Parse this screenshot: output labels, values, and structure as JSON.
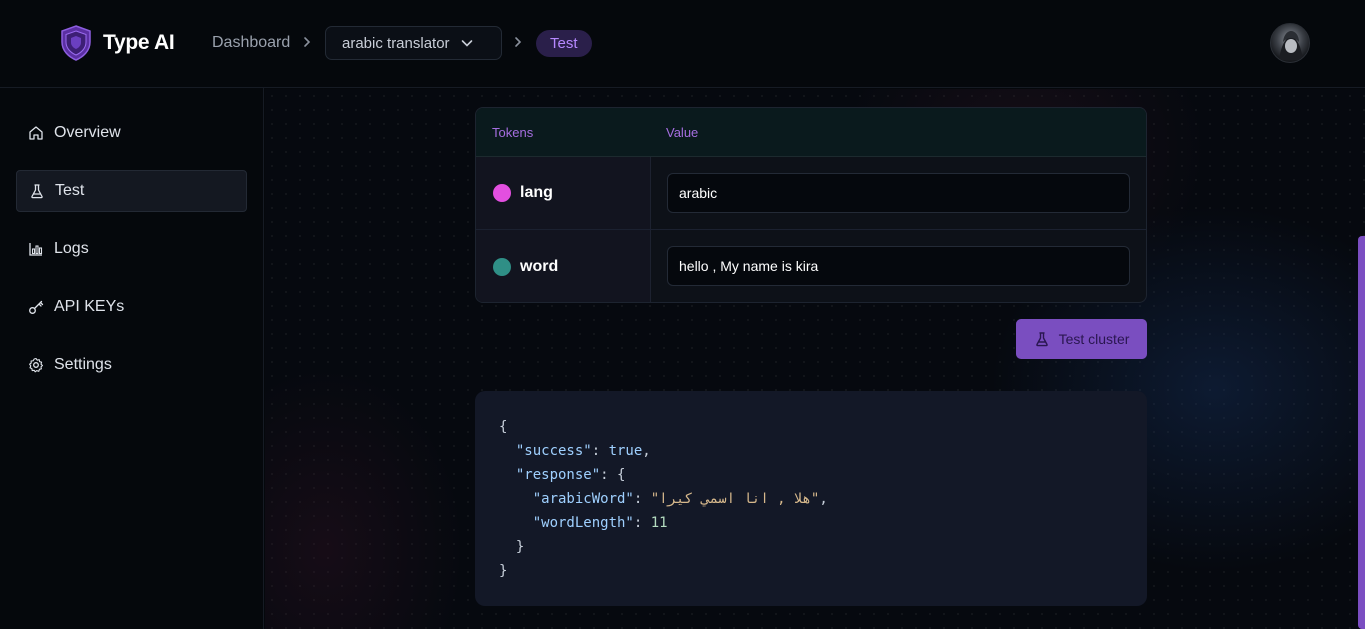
{
  "header": {
    "brand": "Type AI",
    "breadcrumb_dashboard": "Dashboard",
    "project_select": "arabic translator",
    "current_page_badge": "Test"
  },
  "sidebar": {
    "items": [
      {
        "label": "Overview",
        "icon": "home-icon",
        "active": false
      },
      {
        "label": "Test",
        "icon": "flask-icon",
        "active": true
      },
      {
        "label": "Logs",
        "icon": "bar-chart-icon",
        "active": false
      },
      {
        "label": "API KEYs",
        "icon": "key-icon",
        "active": false
      },
      {
        "label": "Settings",
        "icon": "gear-icon",
        "active": false
      }
    ]
  },
  "tokens": {
    "header_tokens": "Tokens",
    "header_value": "Value",
    "rows": [
      {
        "name": "lang",
        "value": "arabic",
        "color": "#e34fe0"
      },
      {
        "name": "word",
        "value": "hello , My name is kira",
        "color": "#2f8f86"
      }
    ]
  },
  "test_button": {
    "label": "Test cluster",
    "icon": "flask-icon"
  },
  "response": {
    "open_brace": "{",
    "success_key": "\"success\"",
    "success_value": "true",
    "response_key": "\"response\"",
    "arabicWord_key": "\"arabicWord\"",
    "arabicWord_value": "\"هلا , انا اسمي كيرا\"",
    "wordLength_key": "\"wordLength\"",
    "wordLength_value": "11",
    "inner_close": "}",
    "close_brace": "}"
  },
  "colors": {
    "accent": "#7a4ec0",
    "badge_text": "#b688ff",
    "token_header_text": "#a56ee0"
  }
}
